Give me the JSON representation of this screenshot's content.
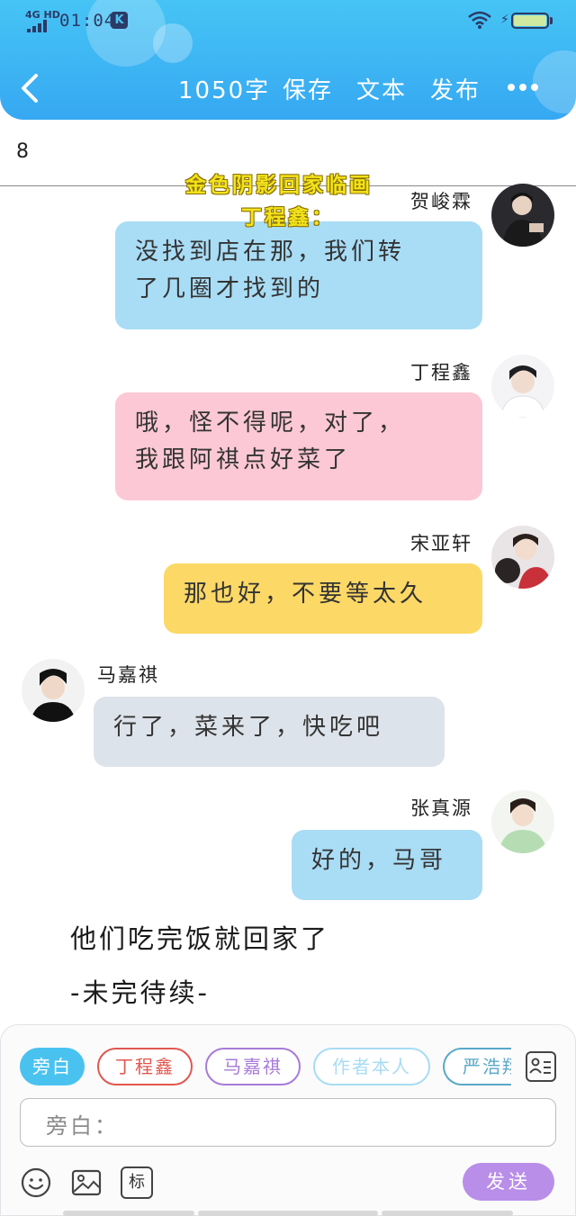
{
  "status_bar": {
    "network": "4G HD",
    "time": "01:04",
    "app_badge": "K",
    "battery": "[battery]"
  },
  "toolbar": {
    "word_count": "1050字",
    "save_label": "保存",
    "text_label": "文本",
    "publish_label": "发布"
  },
  "title": {
    "value": "8"
  },
  "overlay": {
    "line1": "金色阴影回家临画",
    "line2": "丁程鑫："
  },
  "messages": [
    {
      "speaker": "贺峻霖",
      "side": "right",
      "color": "#a9dcf5",
      "lines": [
        "没找到店在那，我们转",
        "了几圈才找到的"
      ]
    },
    {
      "speaker": "丁程鑫",
      "side": "right",
      "color": "#fcc8d5",
      "lines": [
        "哦，怪不得呢，对了，",
        "我跟阿祺点好菜了"
      ]
    },
    {
      "speaker": "宋亚轩",
      "side": "right",
      "color": "#fcd866",
      "lines": [
        "那也好，不要等太久"
      ]
    },
    {
      "speaker": "马嘉祺",
      "side": "left",
      "color": "#dde3ea",
      "lines": [
        "行了，菜来了，快吃吧"
      ]
    },
    {
      "speaker": "张真源",
      "side": "right",
      "color": "#a9dcf5",
      "lines": [
        "好的，马哥"
      ]
    }
  ],
  "narration": [
    "他们吃完饭就回家了",
    "-未完待续-"
  ],
  "roles": [
    {
      "label": "旁白",
      "color": "#4ac2f0",
      "active": true
    },
    {
      "label": "丁程鑫",
      "color": "#e0574f",
      "active": false
    },
    {
      "label": "马嘉祺",
      "color": "#a77bd9",
      "active": false
    },
    {
      "label": "作者本人",
      "color": "#a8dcf4",
      "active": false
    },
    {
      "label": "严浩翔",
      "color": "#5aa8c8",
      "active": false
    }
  ],
  "input": {
    "placeholder": "旁白："
  },
  "send_label": "发送",
  "icons": {
    "back": "chevron-left-icon",
    "more": "more-dots-icon",
    "roles": "role-list-icon",
    "emoji": "emoji-icon",
    "image": "image-icon",
    "tag": "tag-icon"
  },
  "tag_icon_text": "标"
}
